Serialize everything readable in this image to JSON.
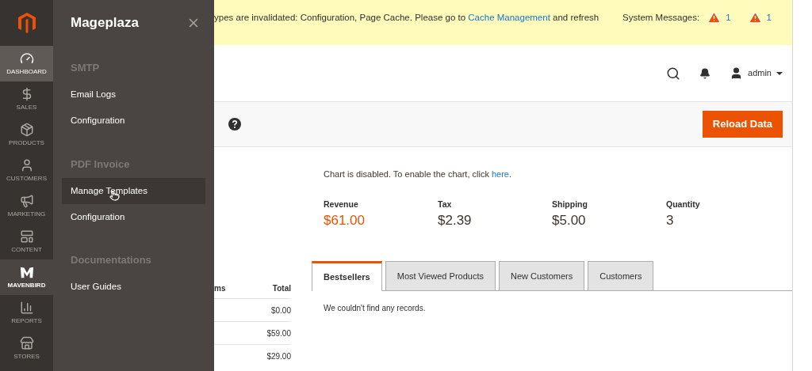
{
  "nav": [
    {
      "label": "DASHBOARD",
      "selected": false,
      "current": true
    },
    {
      "label": "SALES",
      "selected": false,
      "current": false
    },
    {
      "label": "PRODUCTS",
      "selected": false,
      "current": false
    },
    {
      "label": "CUSTOMERS",
      "selected": false,
      "current": false
    },
    {
      "label": "MARKETING",
      "selected": false,
      "current": false
    },
    {
      "label": "CONTENT",
      "selected": false,
      "current": false
    },
    {
      "label": "MAVENBIRD",
      "selected": true,
      "current": false
    },
    {
      "label": "REPORTS",
      "selected": false,
      "current": false
    },
    {
      "label": "STORES",
      "selected": false,
      "current": false
    }
  ],
  "flyout": {
    "title": "Mageplaza",
    "sections": [
      {
        "heading": "SMTP",
        "items": [
          {
            "label": "Email Logs",
            "highlighted": false
          },
          {
            "label": "Configuration",
            "highlighted": false
          }
        ]
      },
      {
        "heading": "PDF Invoice",
        "items": [
          {
            "label": "Manage Templates",
            "highlighted": true
          },
          {
            "label": "Configuration",
            "highlighted": false
          }
        ]
      },
      {
        "heading": "Documentations",
        "items": [
          {
            "label": "User Guides",
            "highlighted": false
          }
        ]
      }
    ]
  },
  "banner": {
    "text": "ypes are invalidated: Configuration, Page Cache. Please go to ",
    "link": "Cache Management",
    "after": " and refresh",
    "system_label": "System Messages:",
    "counts": [
      "1",
      "1"
    ]
  },
  "header": {
    "user": "admin"
  },
  "toolbar": {
    "button": "Reload Data"
  },
  "chart_note": {
    "text": "Chart is disabled. To enable the chart, click ",
    "link": "here",
    "after": "."
  },
  "totals": [
    {
      "label": "Revenue",
      "value": "$61.00",
      "highlight": true
    },
    {
      "label": "Tax",
      "value": "$2.39",
      "highlight": false
    },
    {
      "label": "Shipping",
      "value": "$5.00",
      "highlight": false
    },
    {
      "label": "Quantity",
      "value": "3",
      "highlight": false
    }
  ],
  "tabs": [
    {
      "label": "Bestsellers",
      "selected": true
    },
    {
      "label": "Most Viewed Products",
      "selected": false
    },
    {
      "label": "New Customers",
      "selected": false
    },
    {
      "label": "Customers",
      "selected": false
    }
  ],
  "tab_content": "We couldn't find any records.",
  "table": {
    "columns": [
      "ms",
      "Total"
    ],
    "rows": [
      "$0.00",
      "$59.00",
      "$29.00"
    ]
  }
}
